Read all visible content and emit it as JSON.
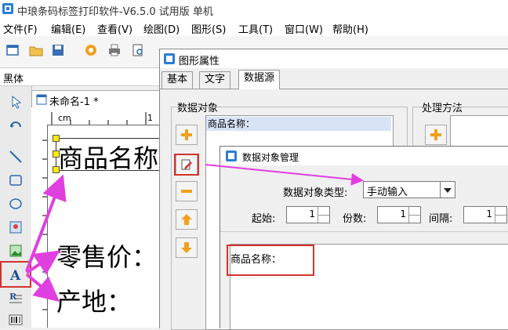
{
  "app": {
    "title": "中琅条码标签打印软件-V6.5.0 试用版 单机"
  },
  "menu": [
    "文件(F)",
    "编辑(E)",
    "查看(V)",
    "绘图(D)",
    "图形(S)",
    "工具(T)",
    "窗口(W)",
    "帮助(H)"
  ],
  "font_bar": {
    "font_name": "黑体"
  },
  "document": {
    "tab_label": "未命名-1 *",
    "ruler_unit": "cm",
    "ruler_mark": "1",
    "label_lines": [
      "商品名称",
      "零售价：",
      "产地："
    ]
  },
  "properties_dialog": {
    "title": "图形属性",
    "tabs": [
      "基本",
      "文字",
      "数据源"
    ],
    "active_tab": "数据源",
    "data_object_group": "数据对象",
    "processing_group": "处理方法",
    "data_list_items": [
      "商品名称："
    ]
  },
  "data_object_dialog": {
    "title": "数据对象管理",
    "type_label": "数据对象类型:",
    "type_value": "手动输入",
    "start_label": "起始:",
    "start_value": "1",
    "copies_label": "份数:",
    "copies_value": "1",
    "interval_label": "间隔:",
    "interval_value": "1",
    "content": "商品名称："
  },
  "colors": {
    "highlight_box": "#d0342c",
    "annotation_arrow": "#e040e0",
    "selection_handle": "#ffeb00",
    "list_selection": "#d8e4f6"
  },
  "icons": [
    "app-icon",
    "new-file-icon",
    "open-folder-icon",
    "save-icon",
    "settings-gear-icon",
    "print-icon",
    "print-preview-icon",
    "pointer-tool-icon",
    "rotate-tool-icon",
    "line-tool-icon",
    "rectangle-tool-icon",
    "ellipse-tool-icon",
    "image-tool-icon",
    "picture-tool-icon",
    "text-tool-icon",
    "rich-text-tool-icon",
    "barcode-tool-icon",
    "add-icon",
    "edit-icon",
    "remove-icon",
    "move-up-icon",
    "move-down-icon",
    "dropdown-arrow-icon"
  ]
}
